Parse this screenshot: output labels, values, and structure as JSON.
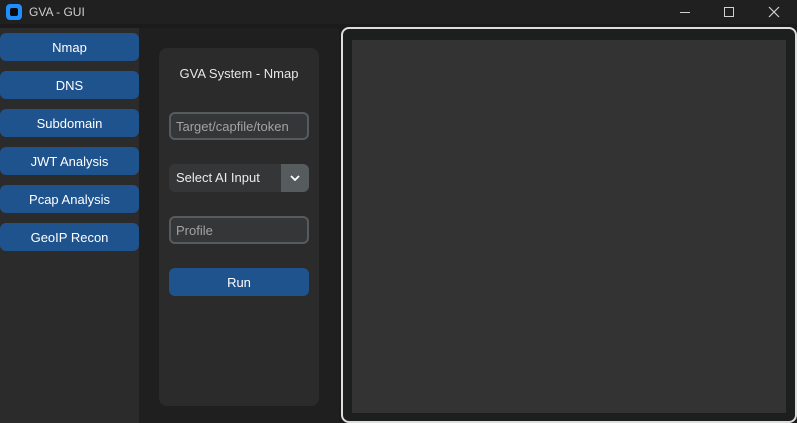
{
  "window": {
    "title": "GVA - GUI"
  },
  "sidebar": {
    "items": [
      {
        "label": "Nmap"
      },
      {
        "label": "DNS"
      },
      {
        "label": "Subdomain"
      },
      {
        "label": "JWT Analysis"
      },
      {
        "label": "Pcap Analysis"
      },
      {
        "label": "GeoIP Recon"
      }
    ]
  },
  "form": {
    "title": "GVA System - Nmap",
    "target_placeholder": "Target/capfile/token",
    "ai_input_selected": "Select AI Input",
    "profile_placeholder": "Profile",
    "run_label": "Run"
  },
  "output": {
    "text": ""
  },
  "colors": {
    "accent": "#1f538d",
    "background": "#1b1b1b",
    "panel": "#2b2b2b",
    "output_bg": "#333333"
  }
}
